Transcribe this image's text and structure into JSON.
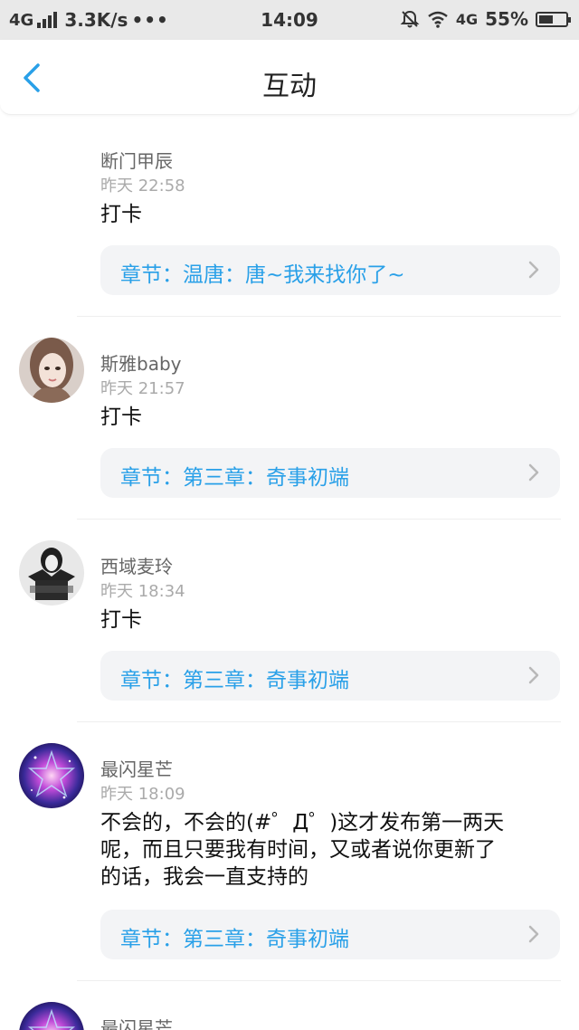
{
  "status_bar": {
    "network": "4G",
    "speed": "3.3K/s",
    "more": "•••",
    "time": "14:09",
    "network_right": "4G",
    "battery_text": "55%",
    "battery_level": 0.55
  },
  "header": {
    "title": "互动"
  },
  "comments": [
    {
      "username": "断门甲辰",
      "time": "昨天 22:58",
      "content": "打卡",
      "chapter": "章节：温唐：唐~我来找你了~"
    },
    {
      "username": "斯雅baby",
      "time": "昨天 21:57",
      "content": "打卡",
      "chapter": "章节：第三章：奇事初端"
    },
    {
      "username": "西域麦玲",
      "time": "昨天 18:34",
      "content": "打卡",
      "chapter": "章节：第三章：奇事初端"
    },
    {
      "username": "最闪星芒",
      "time": "昨天 18:09",
      "content_lines": [
        "不会的，不会的(#゜Д゜)这才发布第一两天",
        "呢，而且只要我有时间，又或者说你更新了",
        "的话，我会一直支持的"
      ],
      "chapter": "章节：第三章：奇事初端"
    },
    {
      "username": "最闪星芒"
    }
  ],
  "colors": {
    "accent": "#29a0e8",
    "chapter_bg": "#f3f4f6"
  }
}
